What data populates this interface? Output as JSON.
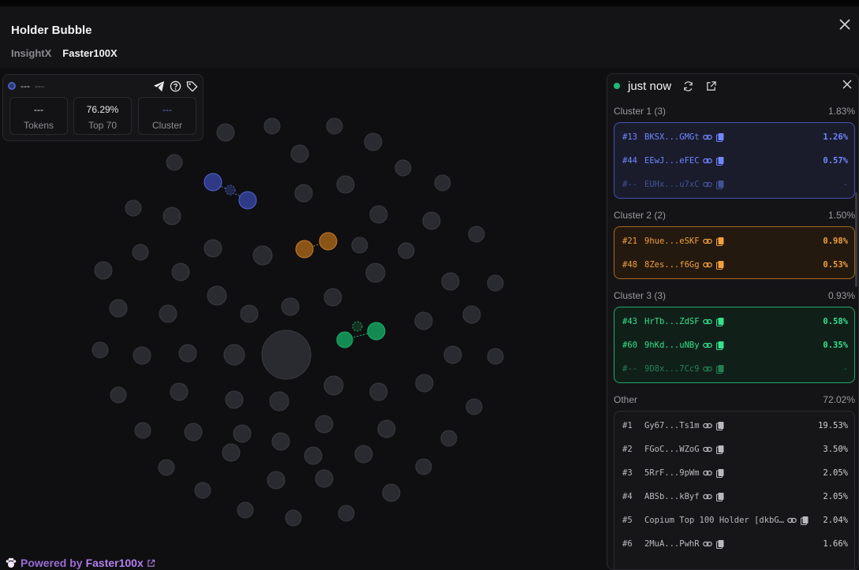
{
  "header": {
    "title": "Holder Bubble",
    "tabs": [
      "InsightX",
      "Faster100X"
    ],
    "active_tab": "Faster100X"
  },
  "stats": {
    "head_label": "---",
    "head_sub": "---",
    "items": [
      {
        "value": "---",
        "label": "Tokens"
      },
      {
        "value": "76.29%",
        "label": "Top 70"
      },
      {
        "value": "---",
        "label": "Cluster"
      }
    ]
  },
  "panel": {
    "status": "just now",
    "clusters": [
      {
        "title": "Cluster 1 (3)",
        "pct": "1.83%",
        "rows": [
          {
            "rank": "#13",
            "addr": "BKSX...GMGt",
            "pct": "1.26%"
          },
          {
            "rank": "#44",
            "addr": "EEwJ...eFEC",
            "pct": "0.57%"
          },
          {
            "rank": "#--",
            "addr": "EUHx...u7xC",
            "pct": "-"
          }
        ]
      },
      {
        "title": "Cluster 2 (2)",
        "pct": "1.50%",
        "rows": [
          {
            "rank": "#21",
            "addr": "9hue...eSKF",
            "pct": "0.98%"
          },
          {
            "rank": "#48",
            "addr": "8Zes...f6Gg",
            "pct": "0.53%"
          }
        ]
      },
      {
        "title": "Cluster 3 (3)",
        "pct": "0.93%",
        "rows": [
          {
            "rank": "#43",
            "addr": "HrTb...ZdSF",
            "pct": "0.58%"
          },
          {
            "rank": "#60",
            "addr": "9hKd...uNBy",
            "pct": "0.35%"
          },
          {
            "rank": "#--",
            "addr": "9D8x...7Cc9",
            "pct": "-"
          }
        ]
      }
    ],
    "other": {
      "title": "Other",
      "pct": "72.02%",
      "rows": [
        {
          "rank": "#1",
          "addr": "Gy67...Ts1m",
          "pct": "19.53%"
        },
        {
          "rank": "#2",
          "addr": "FGoC...WZoG",
          "pct": "3.50%"
        },
        {
          "rank": "#3",
          "addr": "5RrF...9pWm",
          "pct": "2.05%"
        },
        {
          "rank": "#4",
          "addr": "ABSb...kByf",
          "pct": "2.05%"
        },
        {
          "rank": "#5",
          "addr": "Copium Top 100 Holder [dkbG…",
          "pct": "2.04%"
        },
        {
          "rank": "#6",
          "addr": "2MuA...PwhR",
          "pct": "1.66%"
        }
      ]
    }
  },
  "footer": {
    "powered": "Powered by",
    "brand": "Faster100x"
  },
  "colors": {
    "cluster1": "#4a5fc7",
    "cluster2": "#c97a25",
    "cluster3": "#1fa866",
    "bubble": "#2a2b30"
  }
}
